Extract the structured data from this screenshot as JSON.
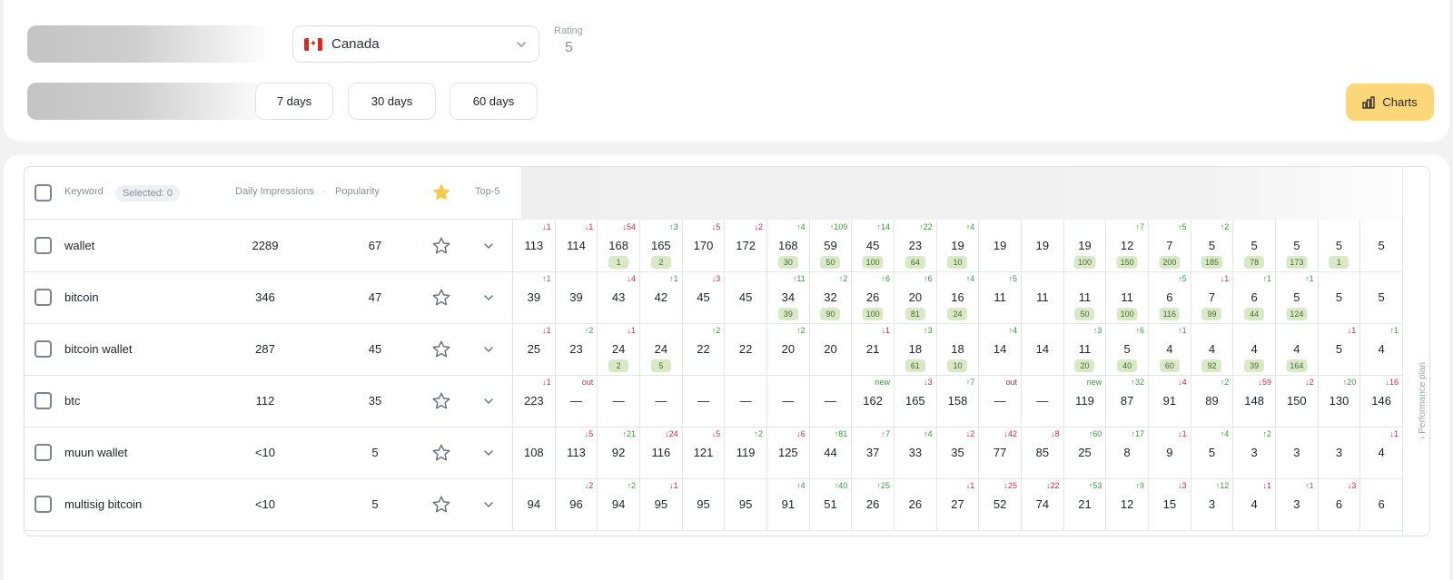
{
  "filters": {
    "country": "Canada",
    "rating_label": "Rating",
    "rating_value": "5",
    "periods": [
      "7 days",
      "30 days",
      "60 days"
    ],
    "charts_label": "Charts"
  },
  "table": {
    "headers": {
      "keyword": "Keyword",
      "selected": "Selected: 0",
      "impressions": "Daily Impressions",
      "popularity": "Popularity",
      "top5": "Top-5"
    },
    "side_label": "Performance plan",
    "rows": [
      {
        "keyword": "wallet",
        "impressions": "2289",
        "popularity": "67",
        "cells": [
          {
            "v": "113",
            "d": "↓1",
            "t": "down"
          },
          {
            "v": "114",
            "d": "↓1",
            "t": "down"
          },
          {
            "v": "168",
            "d": "↓54",
            "t": "down",
            "b": "1"
          },
          {
            "v": "165",
            "d": "↑3",
            "t": "up",
            "b": "2"
          },
          {
            "v": "170",
            "d": "↓5",
            "t": "down"
          },
          {
            "v": "172",
            "d": "↓2",
            "t": "down"
          },
          {
            "v": "168",
            "d": "↑4",
            "t": "up",
            "b": "30"
          },
          {
            "v": "59",
            "d": "↑109",
            "t": "up",
            "b": "50"
          },
          {
            "v": "45",
            "d": "↑14",
            "t": "up",
            "b": "100"
          },
          {
            "v": "23",
            "d": "↑22",
            "t": "up",
            "b": "64"
          },
          {
            "v": "19",
            "d": "↑4",
            "t": "up",
            "b": "10"
          },
          {
            "v": "19"
          },
          {
            "v": "19"
          },
          {
            "v": "19",
            "b": "100"
          },
          {
            "v": "12",
            "d": "↑7",
            "t": "up",
            "b": "150"
          },
          {
            "v": "7",
            "d": "↑5",
            "t": "up",
            "b": "200"
          },
          {
            "v": "5",
            "d": "↑2",
            "t": "up",
            "b": "185"
          },
          {
            "v": "5",
            "b": "78"
          },
          {
            "v": "5",
            "b": "173"
          },
          {
            "v": "5",
            "b": "1"
          },
          {
            "v": "5"
          }
        ]
      },
      {
        "keyword": "bitcoin",
        "impressions": "346",
        "popularity": "47",
        "cells": [
          {
            "v": "39",
            "d": "↑1",
            "t": "up"
          },
          {
            "v": "39"
          },
          {
            "v": "43",
            "d": "↓4",
            "t": "down"
          },
          {
            "v": "42",
            "d": "↑1",
            "t": "up"
          },
          {
            "v": "45",
            "d": "↓3",
            "t": "down"
          },
          {
            "v": "45"
          },
          {
            "v": "34",
            "d": "↑11",
            "t": "up",
            "b": "39"
          },
          {
            "v": "32",
            "d": "↑2",
            "t": "up",
            "b": "90"
          },
          {
            "v": "26",
            "d": "↑6",
            "t": "up",
            "b": "100"
          },
          {
            "v": "20",
            "d": "↑6",
            "t": "up",
            "b": "81"
          },
          {
            "v": "16",
            "d": "↑4",
            "t": "up",
            "b": "24"
          },
          {
            "v": "11",
            "d": "↑5",
            "t": "up"
          },
          {
            "v": "11"
          },
          {
            "v": "11",
            "b": "50"
          },
          {
            "v": "11",
            "b": "100"
          },
          {
            "v": "6",
            "d": "↑5",
            "t": "up",
            "b": "116"
          },
          {
            "v": "7",
            "d": "↓1",
            "t": "down",
            "b": "99"
          },
          {
            "v": "6",
            "d": "↑1",
            "t": "up",
            "b": "44"
          },
          {
            "v": "5",
            "d": "↑1",
            "t": "up",
            "b": "124"
          },
          {
            "v": "5"
          },
          {
            "v": "5"
          }
        ]
      },
      {
        "keyword": "bitcoin wallet",
        "impressions": "287",
        "popularity": "45",
        "cells": [
          {
            "v": "25",
            "d": "↓1",
            "t": "down"
          },
          {
            "v": "23",
            "d": "↑2",
            "t": "up"
          },
          {
            "v": "24",
            "d": "↓1",
            "t": "down",
            "b": "2"
          },
          {
            "v": "24",
            "b": "5"
          },
          {
            "v": "22",
            "d": "↑2",
            "t": "up"
          },
          {
            "v": "22"
          },
          {
            "v": "20",
            "d": "↑2",
            "t": "up"
          },
          {
            "v": "20"
          },
          {
            "v": "21",
            "d": "↓1",
            "t": "down"
          },
          {
            "v": "18",
            "d": "↑3",
            "t": "up",
            "b": "61"
          },
          {
            "v": "18",
            "b": "10"
          },
          {
            "v": "14",
            "d": "↑4",
            "t": "up"
          },
          {
            "v": "14"
          },
          {
            "v": "11",
            "d": "↑3",
            "t": "up",
            "b": "20"
          },
          {
            "v": "5",
            "d": "↑6",
            "t": "up",
            "b": "40"
          },
          {
            "v": "4",
            "d": "↑1",
            "t": "up",
            "b": "60"
          },
          {
            "v": "4",
            "b": "92"
          },
          {
            "v": "4",
            "b": "39"
          },
          {
            "v": "4",
            "b": "164"
          },
          {
            "v": "5",
            "d": "↓1",
            "t": "down"
          },
          {
            "v": "4",
            "d": "↑1",
            "t": "up"
          }
        ]
      },
      {
        "keyword": "btc",
        "impressions": "112",
        "popularity": "35",
        "cells": [
          {
            "v": "223",
            "d": "↓1",
            "t": "down"
          },
          {
            "v": "—",
            "d": "out",
            "t": "out"
          },
          {
            "v": "—"
          },
          {
            "v": "—"
          },
          {
            "v": "—"
          },
          {
            "v": "—"
          },
          {
            "v": "—"
          },
          {
            "v": "—"
          },
          {
            "v": "162",
            "d": "new",
            "t": "new"
          },
          {
            "v": "165",
            "d": "↓3",
            "t": "down"
          },
          {
            "v": "158",
            "d": "↑7",
            "t": "up"
          },
          {
            "v": "—",
            "d": "out",
            "t": "out"
          },
          {
            "v": "—"
          },
          {
            "v": "119",
            "d": "new",
            "t": "new"
          },
          {
            "v": "87",
            "d": "↑32",
            "t": "up"
          },
          {
            "v": "91",
            "d": "↓4",
            "t": "down"
          },
          {
            "v": "89",
            "d": "↑2",
            "t": "up"
          },
          {
            "v": "148",
            "d": "↓59",
            "t": "down"
          },
          {
            "v": "150",
            "d": "↓2",
            "t": "down"
          },
          {
            "v": "130",
            "d": "↑20",
            "t": "up"
          },
          {
            "v": "146",
            "d": "↓16",
            "t": "down"
          }
        ]
      },
      {
        "keyword": "muun wallet",
        "impressions": "<10",
        "popularity": "5",
        "cells": [
          {
            "v": "108"
          },
          {
            "v": "113",
            "d": "↓5",
            "t": "down"
          },
          {
            "v": "92",
            "d": "↑21",
            "t": "up"
          },
          {
            "v": "116",
            "d": "↓24",
            "t": "down"
          },
          {
            "v": "121",
            "d": "↓5",
            "t": "down"
          },
          {
            "v": "119",
            "d": "↑2",
            "t": "up"
          },
          {
            "v": "125",
            "d": "↓6",
            "t": "down"
          },
          {
            "v": "44",
            "d": "↑81",
            "t": "up"
          },
          {
            "v": "37",
            "d": "↑7",
            "t": "up"
          },
          {
            "v": "33",
            "d": "↑4",
            "t": "up"
          },
          {
            "v": "35",
            "d": "↓2",
            "t": "down"
          },
          {
            "v": "77",
            "d": "↓42",
            "t": "down"
          },
          {
            "v": "85",
            "d": "↓8",
            "t": "down"
          },
          {
            "v": "25",
            "d": "↑60",
            "t": "up"
          },
          {
            "v": "8",
            "d": "↑17",
            "t": "up"
          },
          {
            "v": "9",
            "d": "↓1",
            "t": "down"
          },
          {
            "v": "5",
            "d": "↑4",
            "t": "up"
          },
          {
            "v": "3",
            "d": "↑2",
            "t": "up"
          },
          {
            "v": "3"
          },
          {
            "v": "3"
          },
          {
            "v": "4",
            "d": "↓1",
            "t": "down"
          }
        ]
      },
      {
        "keyword": "multisig bitcoin",
        "impressions": "<10",
        "popularity": "5",
        "cells": [
          {
            "v": "94"
          },
          {
            "v": "96",
            "d": "↓2",
            "t": "down"
          },
          {
            "v": "94",
            "d": "↑2",
            "t": "up"
          },
          {
            "v": "95",
            "d": "↓1",
            "t": "down"
          },
          {
            "v": "95"
          },
          {
            "v": "95"
          },
          {
            "v": "91",
            "d": "↑4",
            "t": "up"
          },
          {
            "v": "51",
            "d": "↑40",
            "t": "up"
          },
          {
            "v": "26",
            "d": "↑25",
            "t": "up"
          },
          {
            "v": "26"
          },
          {
            "v": "27",
            "d": "↓1",
            "t": "down"
          },
          {
            "v": "52",
            "d": "↓25",
            "t": "down"
          },
          {
            "v": "74",
            "d": "↓22",
            "t": "down"
          },
          {
            "v": "21",
            "d": "↑53",
            "t": "up"
          },
          {
            "v": "12",
            "d": "↑9",
            "t": "up"
          },
          {
            "v": "15",
            "d": "↓3",
            "t": "down"
          },
          {
            "v": "3",
            "d": "↑12",
            "t": "up"
          },
          {
            "v": "4",
            "d": "↓1",
            "t": "down"
          },
          {
            "v": "3",
            "d": "↑1",
            "t": "up"
          },
          {
            "v": "6",
            "d": "↓3",
            "t": "down"
          },
          {
            "v": "6"
          }
        ]
      }
    ]
  }
}
